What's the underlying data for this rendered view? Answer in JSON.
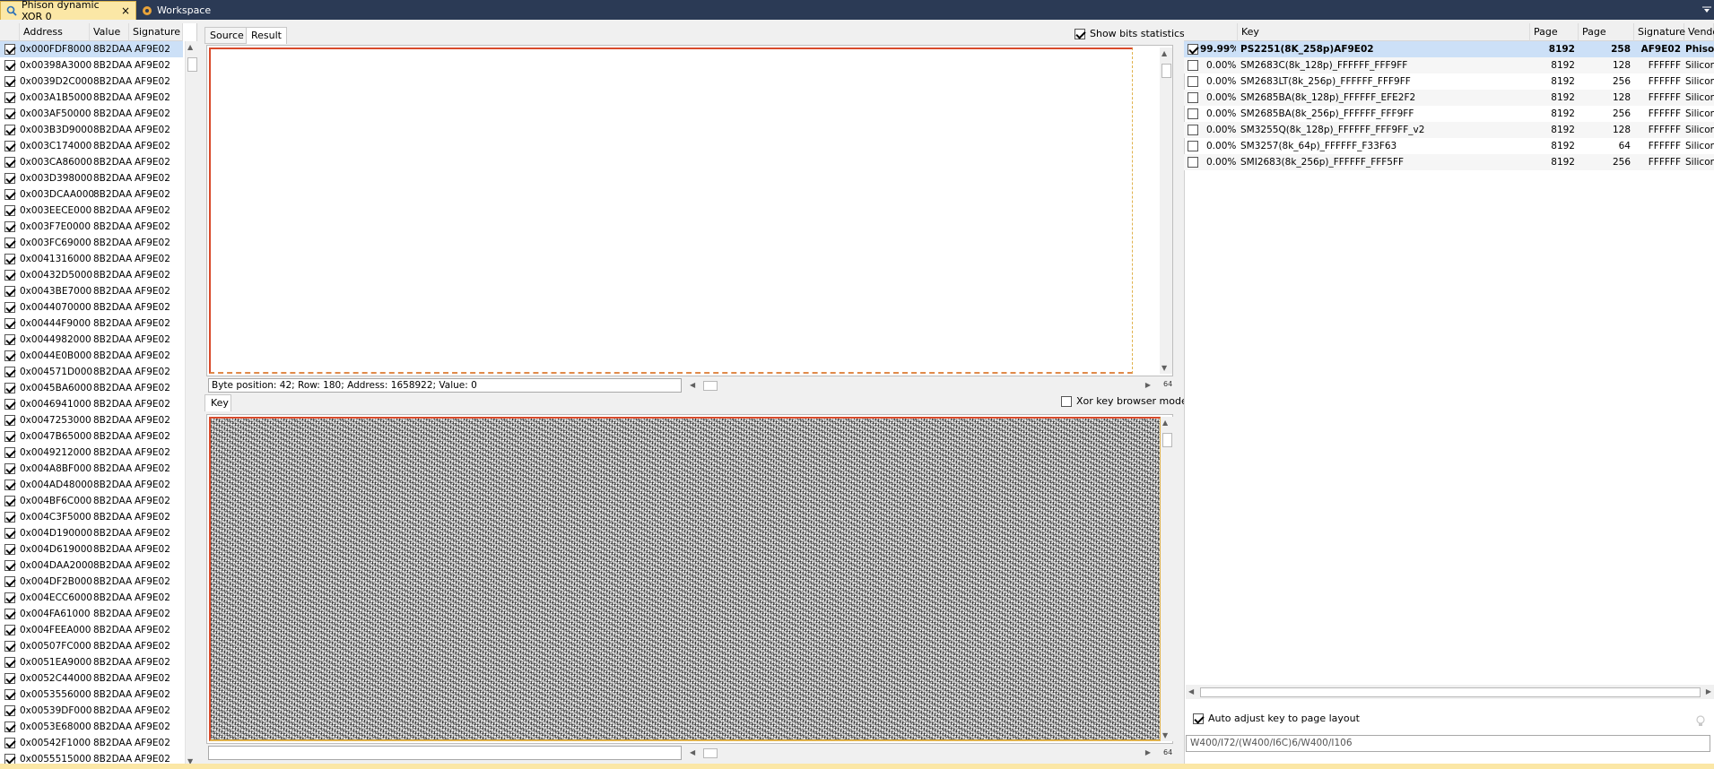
{
  "tabs": {
    "phison": "Phison dynamic XOR 0",
    "workspace": "Workspace",
    "close_glyph": "×"
  },
  "left_table": {
    "headers": [
      "Address",
      "Value",
      "Signature"
    ],
    "rows": [
      {
        "addr": "0x000FDF8000",
        "val": "8B2DAA",
        "sig": "AF9E02"
      },
      {
        "addr": "0x00398A3000",
        "val": "8B2DAA",
        "sig": "AF9E02"
      },
      {
        "addr": "0x0039D2C000",
        "val": "8B2DAA",
        "sig": "AF9E02"
      },
      {
        "addr": "0x003A1B5000",
        "val": "8B2DAA",
        "sig": "AF9E02"
      },
      {
        "addr": "0x003AF50000",
        "val": "8B2DAA",
        "sig": "AF9E02"
      },
      {
        "addr": "0x003B3D9000",
        "val": "8B2DAA",
        "sig": "AF9E02"
      },
      {
        "addr": "0x003C174000",
        "val": "8B2DAA",
        "sig": "AF9E02"
      },
      {
        "addr": "0x003CA86000",
        "val": "8B2DAA",
        "sig": "AF9E02"
      },
      {
        "addr": "0x003D398000",
        "val": "8B2DAA",
        "sig": "AF9E02"
      },
      {
        "addr": "0x003DCAA000",
        "val": "8B2DAA",
        "sig": "AF9E02"
      },
      {
        "addr": "0x003EECE000",
        "val": "8B2DAA",
        "sig": "AF9E02"
      },
      {
        "addr": "0x003F7E0000",
        "val": "8B2DAA",
        "sig": "AF9E02"
      },
      {
        "addr": "0x003FC69000",
        "val": "8B2DAA",
        "sig": "AF9E02"
      },
      {
        "addr": "0x0041316000",
        "val": "8B2DAA",
        "sig": "AF9E02"
      },
      {
        "addr": "0x00432D5000",
        "val": "8B2DAA",
        "sig": "AF9E02"
      },
      {
        "addr": "0x0043BE7000",
        "val": "8B2DAA",
        "sig": "AF9E02"
      },
      {
        "addr": "0x0044070000",
        "val": "8B2DAA",
        "sig": "AF9E02"
      },
      {
        "addr": "0x00444F9000",
        "val": "8B2DAA",
        "sig": "AF9E02"
      },
      {
        "addr": "0x0044982000",
        "val": "8B2DAA",
        "sig": "AF9E02"
      },
      {
        "addr": "0x0044E0B000",
        "val": "8B2DAA",
        "sig": "AF9E02"
      },
      {
        "addr": "0x004571D000",
        "val": "8B2DAA",
        "sig": "AF9E02"
      },
      {
        "addr": "0x0045BA6000",
        "val": "8B2DAA",
        "sig": "AF9E02"
      },
      {
        "addr": "0x0046941000",
        "val": "8B2DAA",
        "sig": "AF9E02"
      },
      {
        "addr": "0x0047253000",
        "val": "8B2DAA",
        "sig": "AF9E02"
      },
      {
        "addr": "0x0047B65000",
        "val": "8B2DAA",
        "sig": "AF9E02"
      },
      {
        "addr": "0x0049212000",
        "val": "8B2DAA",
        "sig": "AF9E02"
      },
      {
        "addr": "0x004A8BF000",
        "val": "8B2DAA",
        "sig": "AF9E02"
      },
      {
        "addr": "0x004AD48000",
        "val": "8B2DAA",
        "sig": "AF9E02"
      },
      {
        "addr": "0x004BF6C000",
        "val": "8B2DAA",
        "sig": "AF9E02"
      },
      {
        "addr": "0x004C3F5000",
        "val": "8B2DAA",
        "sig": "AF9E02"
      },
      {
        "addr": "0x004D190000",
        "val": "8B2DAA",
        "sig": "AF9E02"
      },
      {
        "addr": "0x004D619000",
        "val": "8B2DAA",
        "sig": "AF9E02"
      },
      {
        "addr": "0x004DAA2000",
        "val": "8B2DAA",
        "sig": "AF9E02"
      },
      {
        "addr": "0x004DF2B000",
        "val": "8B2DAA",
        "sig": "AF9E02"
      },
      {
        "addr": "0x004ECC6000",
        "val": "8B2DAA",
        "sig": "AF9E02"
      },
      {
        "addr": "0x004FA61000",
        "val": "8B2DAA",
        "sig": "AF9E02"
      },
      {
        "addr": "0x004FEEA000",
        "val": "8B2DAA",
        "sig": "AF9E02"
      },
      {
        "addr": "0x00507FC000",
        "val": "8B2DAA",
        "sig": "AF9E02"
      },
      {
        "addr": "0x0051EA9000",
        "val": "8B2DAA",
        "sig": "AF9E02"
      },
      {
        "addr": "0x0052C44000",
        "val": "8B2DAA",
        "sig": "AF9E02"
      },
      {
        "addr": "0x0053556000",
        "val": "8B2DAA",
        "sig": "AF9E02"
      },
      {
        "addr": "0x00539DF000",
        "val": "8B2DAA",
        "sig": "AF9E02"
      },
      {
        "addr": "0x0053E68000",
        "val": "8B2DAA",
        "sig": "AF9E02"
      },
      {
        "addr": "0x00542F1000",
        "val": "8B2DAA",
        "sig": "AF9E02"
      },
      {
        "addr": "0x0055515000",
        "val": "8B2DAA",
        "sig": "AF9E02"
      }
    ]
  },
  "middle": {
    "tab_source": "Source",
    "tab_result": "Result",
    "show_bits_label": "Show bits statistics",
    "status_text": "Byte position: 42; Row: 180; Address: 1658922; Value: 0",
    "key_tab": "Key",
    "xor_browser_label": "Xor key browser mode",
    "corner_label": "64"
  },
  "right_table": {
    "headers": [
      "Key",
      "Page size",
      "Page count",
      "Signature",
      "Vendor"
    ],
    "rows": [
      {
        "pct": "99.99%",
        "key": "PS2251(8K_258p)AF9E02",
        "size": "8192",
        "count": "258",
        "sig": "AF9E02",
        "vendor": "Phison(PS)",
        "checked": true
      },
      {
        "pct": "0.00%",
        "key": "SM2683C(8k_128p)_FFFFFF_FFF9FF",
        "size": "8192",
        "count": "128",
        "sig": "FFFFFF",
        "vendor": "SiliconMotion(S",
        "checked": false
      },
      {
        "pct": "0.00%",
        "key": "SM2683LT(8k_256p)_FFFFFF_FFF9FF",
        "size": "8192",
        "count": "256",
        "sig": "FFFFFF",
        "vendor": "SiliconMotion(S",
        "checked": false
      },
      {
        "pct": "0.00%",
        "key": "SM2685BA(8k_128p)_FFFFFF_EFE2F2",
        "size": "8192",
        "count": "128",
        "sig": "FFFFFF",
        "vendor": "SiliconMotion(S",
        "checked": false
      },
      {
        "pct": "0.00%",
        "key": "SM2685BA(8k_256p)_FFFFFF_FFF9FF",
        "size": "8192",
        "count": "256",
        "sig": "FFFFFF",
        "vendor": "SiliconMotion(S",
        "checked": false
      },
      {
        "pct": "0.00%",
        "key": "SM3255Q(8k_128p)_FFFFFF_FFF9FF_v2",
        "size": "8192",
        "count": "128",
        "sig": "FFFFFF",
        "vendor": "SiliconMotion(S",
        "checked": false
      },
      {
        "pct": "0.00%",
        "key": "SM3257(8k_64p)_FFFFFF_F33F63",
        "size": "8192",
        "count": "64",
        "sig": "FFFFFF",
        "vendor": "SiliconMotion(S",
        "checked": false
      },
      {
        "pct": "0.00%",
        "key": "SMI2683(8k_256p)_FFFFFF_FFF5FF",
        "size": "8192",
        "count": "256",
        "sig": "FFFFFF",
        "vendor": "SiliconMotion(S",
        "checked": false
      }
    ],
    "auto_adjust_label": "Auto adjust key to page layout",
    "layout_value": "W400/I72/(W400/I6C)6/W400/I106"
  },
  "colors": {
    "titlebar": "#2b3a55",
    "active_tab": "#fbe7a6",
    "selection": "#cce0f7",
    "frame_red": "#d84a2b",
    "frame_orange": "#e0b24c"
  }
}
